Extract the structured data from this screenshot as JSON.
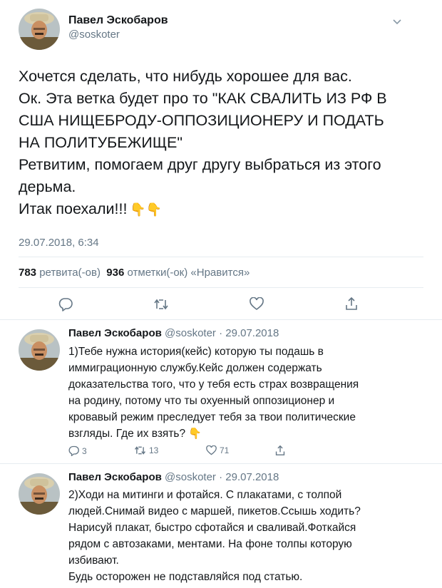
{
  "main_tweet": {
    "author_name": "Павел Эскобаров",
    "author_handle": "@soskoter",
    "lines": [
      "Хочется сделать, что нибудь хорошее для вас.",
      "Ок. Эта ветка будет про то \"КАК СВАЛИТЬ ИЗ РФ В",
      "США НИЩЕБРОДУ-ОППОЗИЦИОНЕРУ И ПОДАТЬ",
      "НА ПОЛИТУБЕЖИЩЕ\"",
      "Ретвитим, помогаем друг другу выбраться из этого",
      "дерьма.",
      "Итак поехали!!!"
    ],
    "emoji": "👇👇",
    "timestamp": "29.07.2018, 6:34",
    "retweet_count": "783",
    "retweet_label": "ретвита(-ов)",
    "like_count": "936",
    "like_label": "отметки(-ок) «Нравится»"
  },
  "replies": [
    {
      "author_name": "Павел Эскобаров",
      "author_handle": "@soskoter",
      "date": "· 29.07.2018",
      "lines": [
        "1)Тебе нужна история(кейс) которую ты подашь в",
        "иммиграционную службу.Кейс должен содержать",
        "доказательства того, что у тебя есть страх возвращения",
        "на родину, потому что ты охуенный оппозиционер и",
        "кровавый режим преследует тебя за твои политические",
        "взгляды. Где их взять?"
      ],
      "emoji": "👇",
      "reply_count": "3",
      "retweet_count": "13",
      "like_count": "71"
    },
    {
      "author_name": "Павел Эскобаров",
      "author_handle": "@soskoter",
      "date": "· 29.07.2018",
      "lines": [
        "2)Ходи на митинги и фотайся. С плакатами, с толпой",
        "людей.Снимай видео с маршей, пикетов.Ссышь ходить?",
        "Нарисуй плакат, быстро сфотайся и сваливай.Фоткайся",
        "рядом с автозаками, ментами. На фоне толпы которую",
        "избивают.",
        "Будь осторожен не подставляйся под статью."
      ]
    }
  ],
  "colors": {
    "text": "#14171a",
    "secondary": "#657786",
    "divider": "#e6ecf0"
  },
  "icons": [
    "caret-down-icon",
    "reply-icon",
    "retweet-icon",
    "like-icon",
    "share-icon"
  ]
}
